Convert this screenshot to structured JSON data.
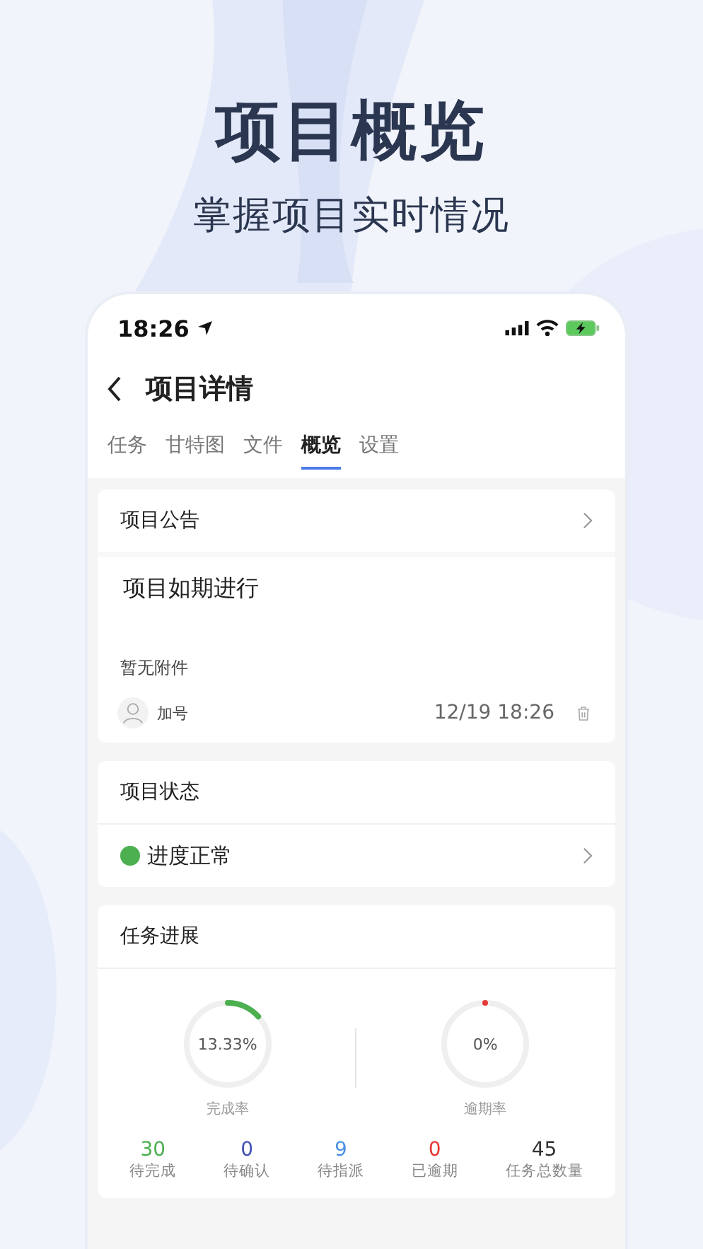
{
  "headline": "项目概览",
  "subtitle": "掌握项目实时情况",
  "status_bar": {
    "time": "18:26"
  },
  "nav": {
    "title": "项目详情"
  },
  "tabs": [
    {
      "label": "任务",
      "selected": false
    },
    {
      "label": "甘特图",
      "selected": false
    },
    {
      "label": "文件",
      "selected": false
    },
    {
      "label": "概览",
      "selected": true
    },
    {
      "label": "设置",
      "selected": false
    }
  ],
  "announcement": {
    "title": "项目公告",
    "content": "项目如期进行",
    "attachments": "暂无附件",
    "author": "加号",
    "time": "12/19 18:26"
  },
  "project_status": {
    "title": "项目状态",
    "status": "进度正常",
    "color": "#4caf50"
  },
  "task_progress": {
    "title": "任务进展",
    "gauges": [
      {
        "reading": "13.33%",
        "label": "完成率",
        "level": 0.1333,
        "color": "#4caf50"
      },
      {
        "reading": "0%",
        "label": "逾期率",
        "level": 0,
        "color": "#e53935"
      }
    ],
    "stats": [
      {
        "value": "30",
        "label": "待完成",
        "color": "#4caf50"
      },
      {
        "value": "0",
        "label": "待确认",
        "color": "#3f51b5"
      },
      {
        "value": "9",
        "label": "待指派",
        "color": "#4a90e2"
      },
      {
        "value": "0",
        "label": "已逾期",
        "color": "#e53935"
      },
      {
        "value": "45",
        "label": "任务总数量",
        "color": "#333333"
      }
    ]
  }
}
